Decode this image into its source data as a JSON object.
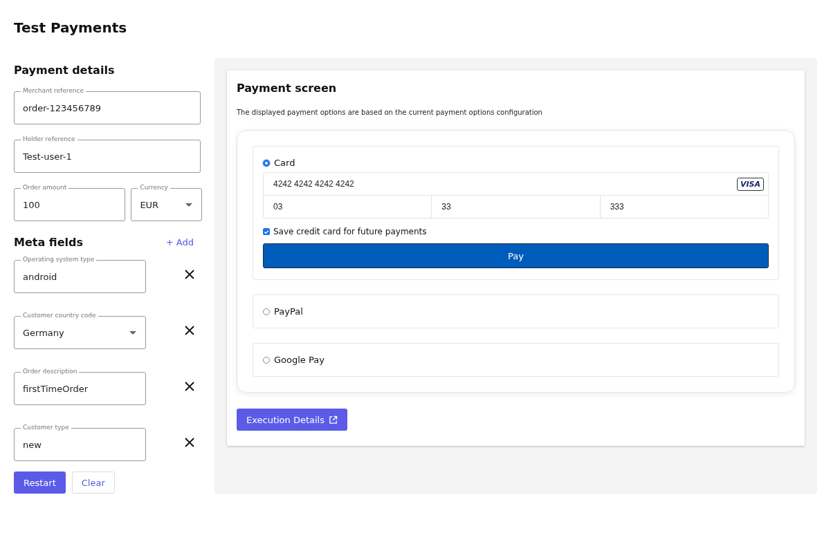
{
  "page_title": "Test Payments",
  "payment_details": {
    "title": "Payment details",
    "fields": [
      {
        "label": "Merchant reference",
        "value": "order-123456789",
        "kind": "text"
      },
      {
        "label": "Holder reference",
        "value": "Test-user-1",
        "kind": "text"
      }
    ],
    "amount": {
      "label": "Order amount",
      "value": "100",
      "kind": "text"
    },
    "currency": {
      "label": "Currency",
      "value": "EUR",
      "kind": "select"
    }
  },
  "meta_fields": {
    "title": "Meta fields",
    "add_label": "+ Add",
    "items": [
      {
        "label": "Operating system type",
        "value": "android",
        "kind": "text"
      },
      {
        "label": "Customer country code",
        "value": "Germany",
        "kind": "select"
      },
      {
        "label": "Order description",
        "value": "firstTimeOrder",
        "kind": "text"
      },
      {
        "label": "Customer type",
        "value": "new",
        "kind": "text"
      }
    ]
  },
  "buttons": [
    {
      "label": "Restart",
      "kind": "primary"
    },
    {
      "label": "Clear",
      "kind": "secondary"
    }
  ],
  "payment_screen": {
    "title": "Payment screen",
    "description": "The displayed payment options are based on the current payment options configuration",
    "methods": [
      {
        "label": "Card",
        "selected": true
      },
      {
        "label": "PayPal",
        "selected": false
      },
      {
        "label": "Google Pay",
        "selected": false
      }
    ],
    "card": {
      "number": "4242 4242 4242 4242",
      "brand": "VISA",
      "expiry_month": "03",
      "expiry_year": "33",
      "cvc": "333",
      "save_label": "Save credit card for future payments",
      "save_checked": true,
      "pay_label": "Pay"
    },
    "execution_button": "Execution Details"
  }
}
